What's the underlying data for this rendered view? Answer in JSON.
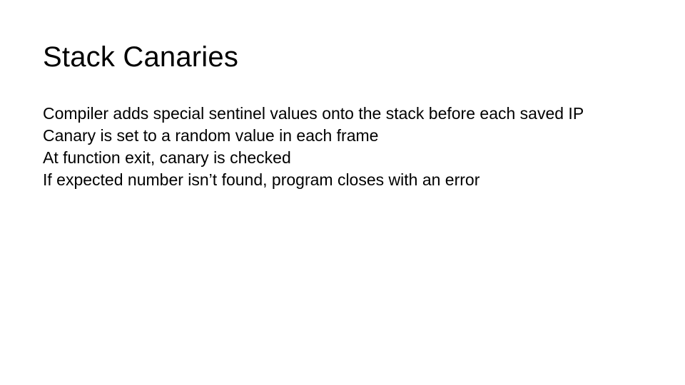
{
  "slide": {
    "title": "Stack Canaries",
    "lines": [
      "Compiler adds special sentinel values onto the stack before each saved IP",
      "Canary is set to a random value in each frame",
      "At function exit, canary is checked",
      "If expected number isn’t found, program closes with an error"
    ]
  }
}
